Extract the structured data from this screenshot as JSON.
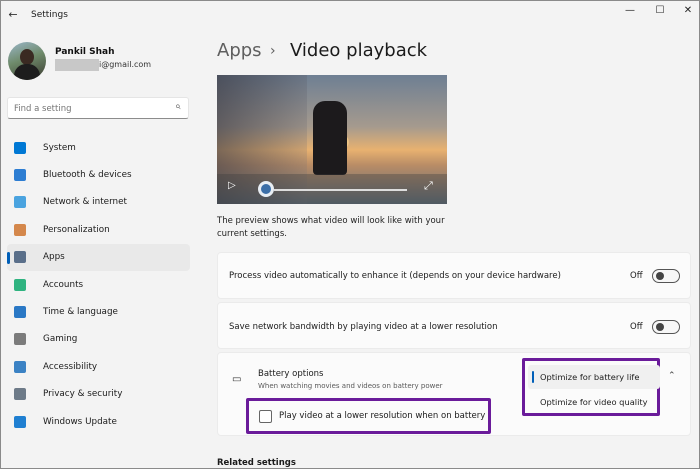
{
  "window": {
    "title": "Settings",
    "back_icon": "←",
    "minimize_icon": "—",
    "maximize_icon": "☐",
    "close_icon": "✕"
  },
  "profile": {
    "name": "Pankil Shah",
    "email": "i@gmail.com"
  },
  "search": {
    "placeholder": "Find a setting",
    "icon": "⌕"
  },
  "sidebar": {
    "items": [
      {
        "label": "System",
        "icon_color": "#0078d4",
        "active": false
      },
      {
        "label": "Bluetooth & devices",
        "icon_color": "#2d7dd2",
        "active": false
      },
      {
        "label": "Network & internet",
        "icon_color": "#4aa3df",
        "active": false
      },
      {
        "label": "Personalization",
        "icon_color": "#d4874b",
        "active": false
      },
      {
        "label": "Apps",
        "icon_color": "#5a6f8a",
        "active": true
      },
      {
        "label": "Accounts",
        "icon_color": "#2fb380",
        "active": false
      },
      {
        "label": "Time & language",
        "icon_color": "#2a78c5",
        "active": false
      },
      {
        "label": "Gaming",
        "icon_color": "#7b7b7b",
        "active": false
      },
      {
        "label": "Accessibility",
        "icon_color": "#3b82c4",
        "active": false
      },
      {
        "label": "Privacy & security",
        "icon_color": "#6d7a88",
        "active": false
      },
      {
        "label": "Windows Update",
        "icon_color": "#1f7fd1",
        "active": false
      }
    ]
  },
  "breadcrumb": {
    "parent": "Apps",
    "separator": "›",
    "current": "Video playback"
  },
  "preview": {
    "play_icon": "▷",
    "expand_icon": "⤢",
    "progress": 0,
    "description": "The preview shows what video will look like with your current settings."
  },
  "settings": {
    "enhance": {
      "label": "Process video automatically to enhance it (depends on your device hardware)",
      "state": "Off"
    },
    "bandwidth": {
      "label": "Save network bandwidth by playing video at a lower resolution",
      "state": "Off"
    },
    "battery": {
      "icon": "▭",
      "title": "Battery options",
      "subtitle": "When watching movies and videos on battery power",
      "chevron": "⌃",
      "options": [
        "Optimize for battery life",
        "Optimize for video quality"
      ],
      "selected": "Optimize for battery life",
      "checkbox_label": "Play video at a lower resolution when on battery",
      "checkbox_checked": false
    }
  },
  "related": {
    "heading": "Related settings"
  },
  "colors": {
    "accent": "#005fb8",
    "highlight": "#6a1b9a"
  }
}
